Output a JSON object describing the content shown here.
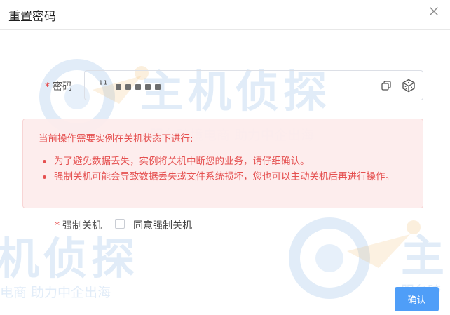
{
  "dialog": {
    "title": "重置密码",
    "close_icon": "close-icon"
  },
  "password": {
    "required_mark": "*",
    "label": "密码",
    "value_prefix": "¹¹",
    "copy_icon": "copy-icon",
    "generate_icon": "dice-icon"
  },
  "alert": {
    "heading": "当前操作需要实例在关机状态下进行:",
    "items": [
      "为了避免数据丢失，实例将关机中断您的业务，请仔细确认。",
      "强制关机可能会导致数据丢失或文件系统损坏，您也可以主动关机后再进行操作。"
    ],
    "color": "#e55050",
    "background": "#fdecec"
  },
  "force_shutdown": {
    "required_mark": "*",
    "label": "强制关机",
    "checkbox_label": "同意强制关机",
    "checked": false
  },
  "footer": {
    "confirm_label": "确认",
    "accent": "#4f9ef8"
  },
  "watermark": {
    "brand": "主机侦探",
    "slogan": "服务跨境电商 助力中企出海",
    "slogan_partial_left": "电商  助力中企出海",
    "brand_partial_left": "机侦探",
    "brand_partial_right": "主",
    "slogan_partial_right": "服务跨"
  }
}
